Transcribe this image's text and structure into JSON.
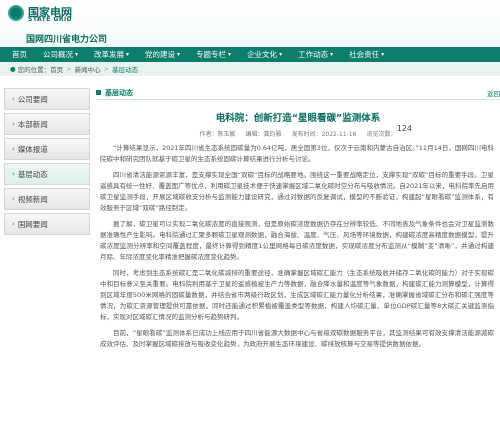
{
  "header": {
    "logo_cn": "国家电网",
    "logo_en": "STATE GRID",
    "site_name": "国网四川省电力公司"
  },
  "nav": {
    "items": [
      {
        "label": "首页",
        "arrow": ""
      },
      {
        "label": "公司概况",
        "arrow": "▾"
      },
      {
        "label": "改革发展",
        "arrow": "▾"
      },
      {
        "label": "党的建设",
        "arrow": "▾"
      },
      {
        "label": "专题专栏",
        "arrow": "▾"
      },
      {
        "label": "企业文化",
        "arrow": "▾"
      },
      {
        "label": "工作动态",
        "arrow": "▾"
      },
      {
        "label": "社会责任",
        "arrow": "▾"
      }
    ]
  },
  "breadcrumb": {
    "prefix": "您的位置：",
    "home": "首页",
    "level1": "新闻中心",
    "current": "基层动态"
  },
  "sidebar": {
    "items": [
      {
        "label": "公司要闻"
      },
      {
        "label": "本部新闻"
      },
      {
        "label": "媒体报道"
      },
      {
        "label": "基层动态"
      },
      {
        "label": "视频新闻"
      },
      {
        "label": "国网要闻"
      }
    ]
  },
  "main": {
    "section_title": "基层动态",
    "return_label": "返回",
    "article_title": "电科院：创新打造“星眼看碳”监测体系",
    "meta": {
      "author": "作者：陈玉敏",
      "editor": "编辑：龚钧雅",
      "time": "发布时间：2022-11-16",
      "views_label": "浏览次数：",
      "views": "124"
    },
    "paragraphs": [
      "“计算结果显示，2021年四川省生态系统固碳量为0.64亿吨，居全国第3位，仅次于云南和内蒙古自治区。”11月14日，国网四川电科院碳中和研究团队就基于碳卫星的生态系统固碳计算结果进行分析与讨论。",
      "四川省清洁能源资源丰富，是支撑实现全国“双碳”目标的战略要地。围绕这一重要战略定位，支撑实现“双碳”目标的重要手段。卫星遥感具有统一性好、覆盖面广等优点，利用碳卫星技术便于快速掌握区域二氧化碳时空分布与吸收情况。自2021年以来，电科院率先启用碳卫星监测手段，开展区域碳收支分析与监测能力建设研究，通过对数据的反复调试，模型的不断验证，构建起“星眼看碳”监测体系，有效服务于区域“双碳”路径制定。",
      "据了解，碳卫星可以实现二氧化碳浓度的直接观测，但是原始碳浓度数据仍存在分辨率较低、不同地表及气象条件也会对卫星监测数据准确性产生影响。电科院通过汇聚多颗碳卫星观测数据，融合海拔、温度、气压、风场等环境数据，构建碳浓度高精度数据模型，提升碳浓度监测分辨率和空间覆盖程度，最终计算得到精度1公里网格每日碳浓度数据，实现碳浓度分布监测从“模糊”变“清晰”，并通过构建月际、年际浓度变化率精准把握碳浓度变化趋势。",
      "同时，考虑到生态系统碳汇是二氧化碳减排的重要途径，准确掌握区域碳汇能力（生态系统吸收并储存二氧化碳的能力）对于实现碳中和目标意义至关重要。电科院利用基于卫星的遥感植被生产力等数据，融合降水量和温度等气象数据，构建碳汇能力测算模型，计算得到区域年度500米网格的固碳量数据，并结合省市两级行政区划，生成区域碳汇能力量化分析结果，准确掌握省域碳汇分布和碳汇强度等情况，为碳汇资源管理提供可靠依据，同时还能通过积累植被覆盖类型等数据，构建人均碳汇量、单位GDP碳汇量等8大碳汇关键监测指标，实现对区域碳汇情况的监测分析与趋势研判。",
      "目前，“星眼看碳”监测体系已成功上线应用于四川省能源大数据中心与省级双碳数据服务平台，其监测结果可有效支撑清洁能源减碳成效评估、及时掌握区域碳排放与吸收变化趋势，为政府开展生态环境建设、碳排放核算与交易等提供数据依据。"
    ]
  },
  "colors": {
    "brand": "#0d7d6c",
    "nav_bg": "#0d7d6c",
    "title": "#0a6d60"
  }
}
